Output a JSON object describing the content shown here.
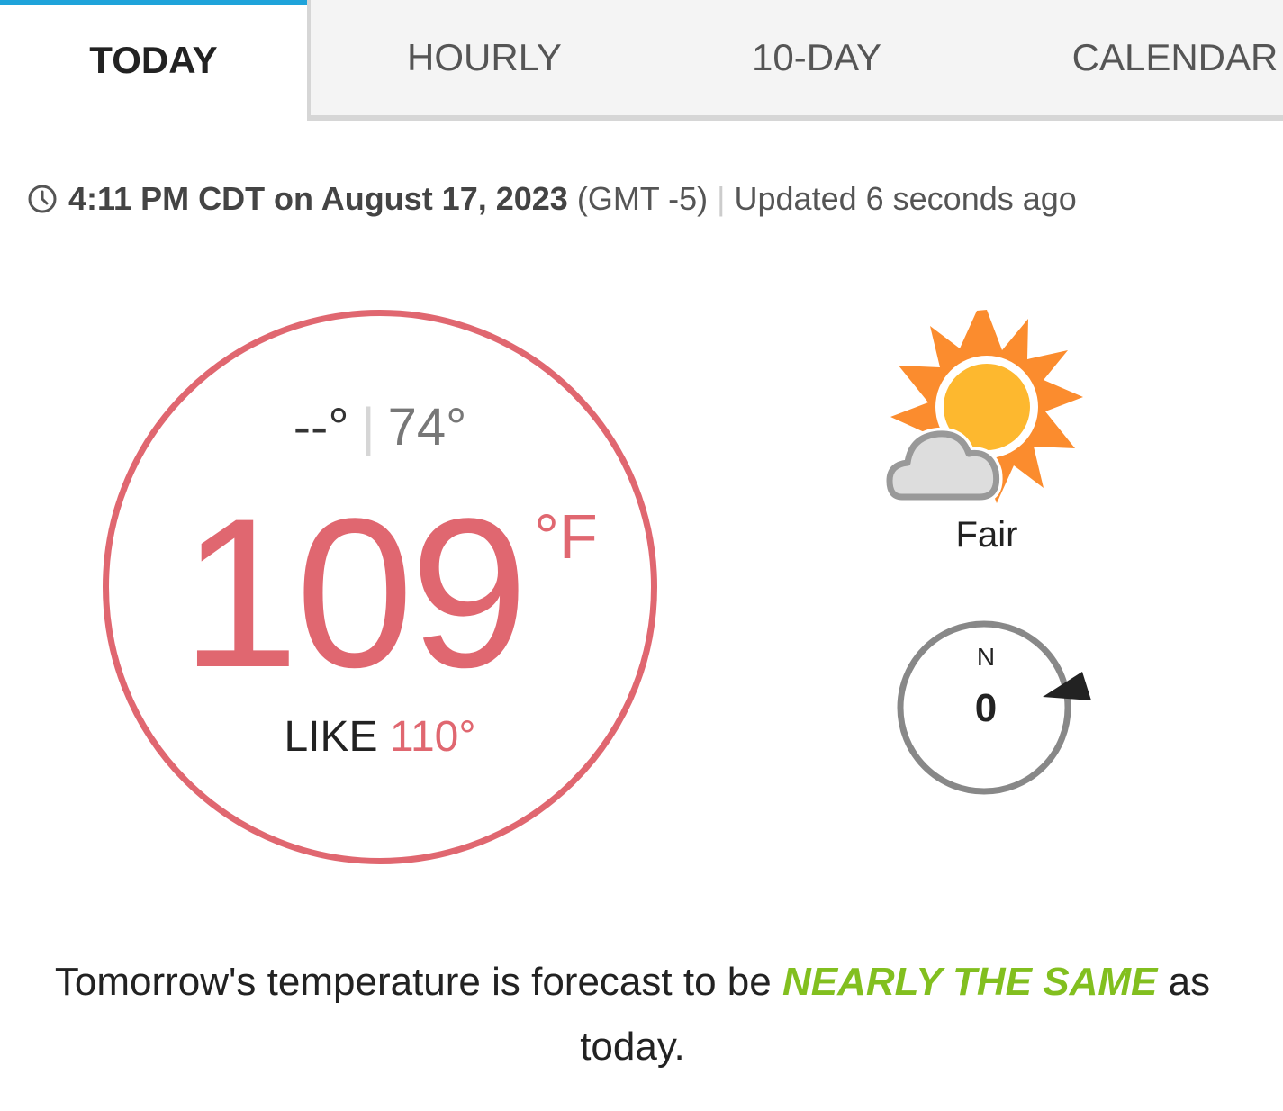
{
  "tabs": [
    {
      "label": "TODAY",
      "active": true
    },
    {
      "label": "HOURLY",
      "active": false
    },
    {
      "label": "10-DAY",
      "active": false
    },
    {
      "label": "CALENDAR",
      "active": false
    }
  ],
  "timestamp": {
    "time": "4:11 PM CDT on August 17, 2023",
    "timezone": "(GMT -5)",
    "separator": "|",
    "updated": "Updated 6 seconds ago",
    "icon": "clock-icon"
  },
  "temperature": {
    "high": "--°",
    "separator": "|",
    "low": "74°",
    "current": "109",
    "unit": "°F",
    "feels_like_label": "LIKE",
    "feels_like_value": "110°",
    "color": "#e06770"
  },
  "condition": {
    "icon": "partly-cloudy-sun-icon",
    "text": "Fair"
  },
  "wind": {
    "direction_label": "N",
    "speed": "0",
    "icon": "wind-compass-icon"
  },
  "forecast": {
    "prefix": "Tomorrow's temperature is forecast to be",
    "emphasis": "NEARLY THE SAME",
    "suffix": "as today.",
    "emphasis_color": "#82bf1f"
  }
}
